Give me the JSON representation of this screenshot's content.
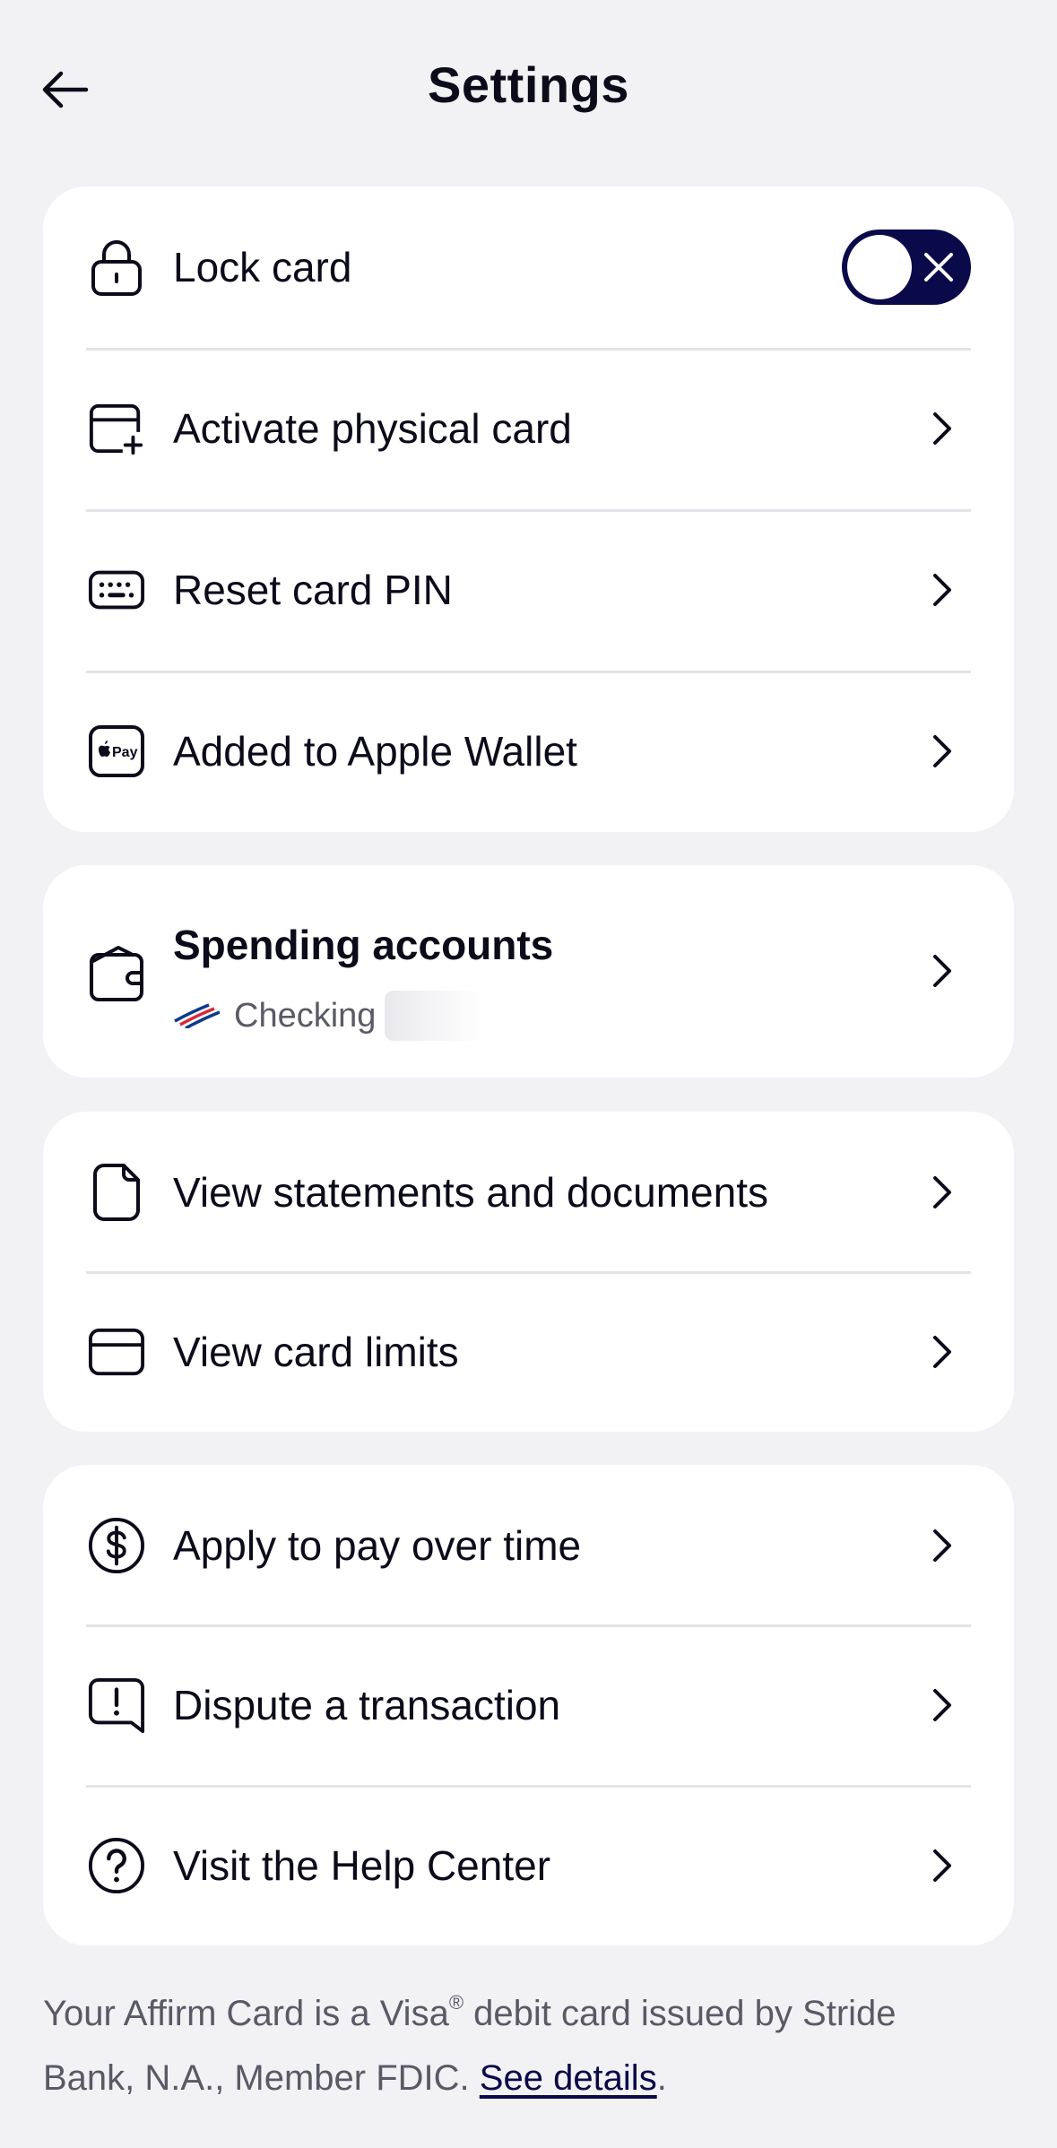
{
  "header": {
    "title": "Settings"
  },
  "card_group": {
    "lock_card": {
      "label": "Lock card",
      "locked": true
    },
    "activate_physical": {
      "label": "Activate physical card"
    },
    "reset_pin": {
      "label": "Reset card PIN"
    },
    "apple_wallet": {
      "label": "Added to Apple Wallet",
      "icon_text": "Pay"
    }
  },
  "spending": {
    "title": "Spending accounts",
    "account_type": "Checking"
  },
  "documents_group": {
    "statements": {
      "label": "View statements and documents"
    },
    "limits": {
      "label": "View card limits"
    }
  },
  "help_group": {
    "pay_over_time": {
      "label": "Apply to pay over time"
    },
    "dispute": {
      "label": "Dispute a transaction"
    },
    "help_center": {
      "label": "Visit the Help Center"
    }
  },
  "footer": {
    "text_before_sup": "Your Affirm Card is a Visa",
    "sup": "®",
    "text_after_sup": " debit card issued by Stride Bank, N.A., Member FDIC. ",
    "link": "See details",
    "period": "."
  },
  "colors": {
    "background": "#f2f2f5",
    "card": "#ffffff",
    "accent": "#0a0a4a",
    "text": "#0b0b1a",
    "muted": "#5a5a66"
  }
}
